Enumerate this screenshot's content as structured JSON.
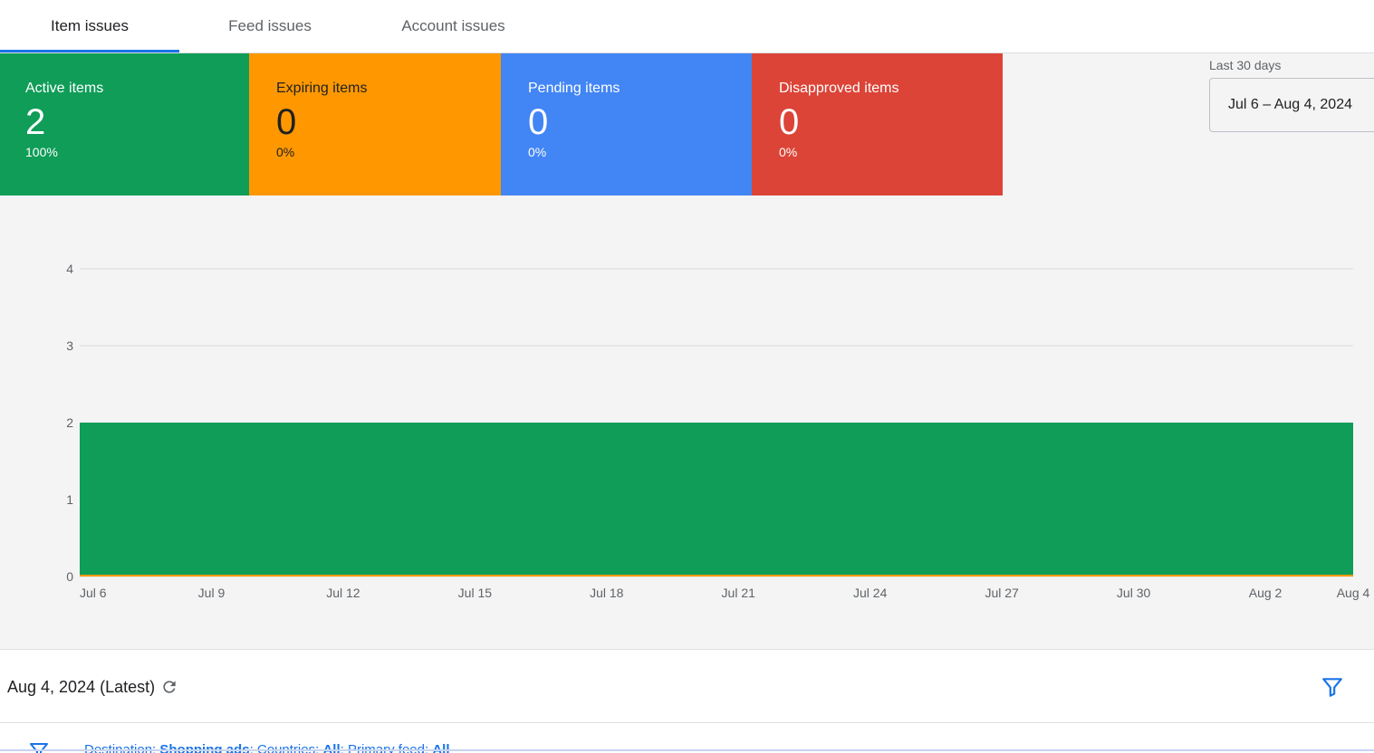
{
  "tabs": [
    {
      "label": "Item issues",
      "active": true
    },
    {
      "label": "Feed issues",
      "active": false
    },
    {
      "label": "Account issues",
      "active": false
    }
  ],
  "cards": [
    {
      "label": "Active items",
      "value": "2",
      "pct": "100%",
      "color": "#0f9d58"
    },
    {
      "label": "Expiring items",
      "value": "0",
      "pct": "0%",
      "color": "#ff9800"
    },
    {
      "label": "Pending items",
      "value": "0",
      "pct": "0%",
      "color": "#4285f4"
    },
    {
      "label": "Disapproved items",
      "value": "0",
      "pct": "0%",
      "color": "#db4437"
    }
  ],
  "date_range": {
    "label": "Last 30 days",
    "value": "Jul 6 – Aug 4, 2024"
  },
  "chart_data": {
    "type": "area",
    "x_ticks": [
      "Jul 6",
      "Jul 9",
      "Jul 12",
      "Jul 15",
      "Jul 18",
      "Jul 21",
      "Jul 24",
      "Jul 27",
      "Jul 30",
      "Aug 2",
      "Aug 4"
    ],
    "y_ticks": [
      "0",
      "1",
      "2",
      "3",
      "4"
    ],
    "ylim": [
      0,
      4
    ],
    "xlim": [
      "2024-07-06",
      "2024-08-04"
    ],
    "series": [
      {
        "name": "Active items",
        "color": "#0f9d58",
        "x": [
          "2024-07-06",
          "2024-08-04"
        ],
        "values": [
          2,
          2
        ]
      },
      {
        "name": "Expiring items",
        "color": "#ff9800",
        "x": [
          "2024-07-06",
          "2024-08-04"
        ],
        "values": [
          0,
          0
        ]
      }
    ],
    "grid": true
  },
  "footer": {
    "latest_label": "Aug 4, 2024 (Latest)",
    "refresh_icon": "refresh-icon",
    "filter_icon": "filter-icon"
  },
  "filters": {
    "destination_label": "Destination:",
    "destination_value": "Shopping ads",
    "countries_label": "Countries:",
    "countries_value": "All",
    "primary_feed_label": "Primary feed:",
    "primary_feed_value": "All"
  },
  "colors": {
    "accent": "#1a73e8",
    "green": "#0f9d58",
    "orange": "#ff9800",
    "blue": "#4285f4",
    "red": "#db4437"
  }
}
